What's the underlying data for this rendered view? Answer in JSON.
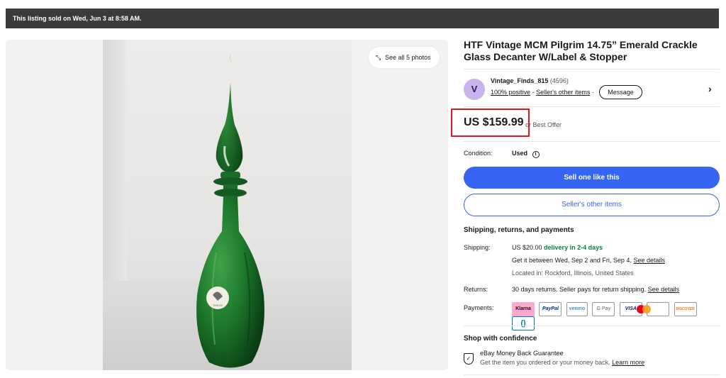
{
  "banner": {
    "text": "This listing sold on Wed, Jun 3 at 8:58 AM."
  },
  "gallery": {
    "see_all_label": "See all 5 photos",
    "label_sticker": "TOKYO"
  },
  "listing": {
    "title": "HTF Vintage MCM Pilgrim 14.75” Emerald Crackle Glass Decanter W/Label & Stopper"
  },
  "seller": {
    "avatar_letter": "V",
    "name": "Vintage_Finds_815",
    "feedback_count": "(4596)",
    "positive": "100% positive",
    "sep": "·",
    "other_items": "Seller's other items",
    "sep2": "·",
    "message_label": "Message",
    "chevron": "›"
  },
  "price": {
    "amount": "US $159.99",
    "best_offer": "or Best Offer"
  },
  "condition": {
    "label": "Condition:",
    "value": "Used",
    "info_icon": "i"
  },
  "buttons": {
    "sell_one": "Sell one like this",
    "seller_items": "Seller's other items"
  },
  "shipping": {
    "section_title": "Shipping, returns, and payments",
    "shipping_label": "Shipping:",
    "cost": "US $20.00",
    "delivery": "delivery in 2-4 days",
    "dates": "Get it between Wed, Sep 2 and Fri, Sep 4.",
    "see_details": "See details",
    "location": "Located in: Rockford, Illinois, United States",
    "returns_label": "Returns:",
    "returns_text": "30 days returns. Seller pays for return shipping.",
    "returns_details": "See details",
    "payments_label": "Payments:",
    "methods": [
      "Klarna",
      "PayPal",
      "venmo",
      "G Pay",
      "VISA",
      "",
      "DISCOVER",
      "()"
    ]
  },
  "confidence": {
    "title": "Shop with confidence",
    "guarantee": "eBay Money Back Guarantee",
    "desc": "Get the item you ordered or your money back.",
    "learn_more": "Learn more"
  },
  "colors": {
    "accent": "#3665f3",
    "price_highlight": "#e0191c",
    "green": "#05823f",
    "bottle": "#1a6b2a"
  }
}
